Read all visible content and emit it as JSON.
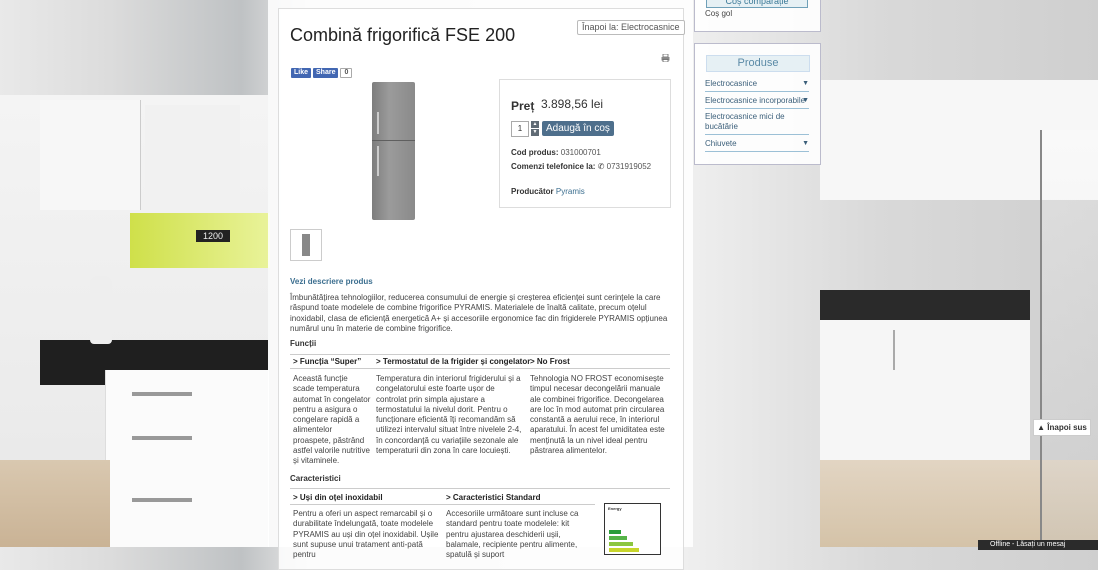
{
  "product": {
    "title": "Combină frigorifică FSE 200",
    "back_link": "Înapoi la: Electrocasnice",
    "price_label": "Preț",
    "price_value": "3.898,56 lei",
    "quantity": "1",
    "add_to_cart": "Adaugă în coș",
    "code_label": "Cod produs:",
    "code_value": "031000701",
    "phone_label": "Comenzi telefonice la:",
    "phone_value": "0731919052",
    "producer_label": "Producător",
    "producer_value": "Pyramis"
  },
  "social": {
    "like": "Like",
    "share": "Share",
    "count": "0"
  },
  "description": {
    "heading": "Vezi descriere produs",
    "text": "Îmbunătățirea tehnologiilor, reducerea consumului de energie și creșterea eficienței sunt cerințele la care răspund toate modelele de combine frigorifice PYRAMIS. Materialele de înaltă calitate, precum oțelul inoxidabil, clasa de eficiență energetică A+ și accesoriile ergonomice fac din frigiderele PYRAMIS opțiunea numărul unu în materie de combine frigorifice."
  },
  "functions": {
    "heading": "Funcții",
    "cols": [
      {
        "title": "> Funcția “Super”",
        "text": "Această funcție scade temperatura automat în congelator pentru a asigura o congelare rapidă a alimentelor proaspete, păstrând astfel valorile nutritive și vitaminele."
      },
      {
        "title": "> Termostatul de la frigider și congelator",
        "text": "Temperatura din interiorul frigiderului și a congelatorului este foarte ușor de controlat prin simpla ajustare a termostatului la nivelul dorit. Pentru o funcționare eficientă îți recomandăm să utilizezi intervalul situat între nivelele 2-4, în concordanță cu variațiile sezonale ale temperaturii din zona în care locuiești."
      },
      {
        "title": "> No Frost",
        "text": "Tehnologia NO FROST economisește timpul necesar decongelării manuale ale combinei frigorifice. Decongelarea are loc în mod automat prin circularea constantă a aerului rece, în interiorul aparatului. În acest fel umiditatea este menținută la un nivel ideal pentru păstrarea alimentelor."
      }
    ]
  },
  "characteristics": {
    "heading": "Caracteristici",
    "cols": [
      {
        "title": "> Uși din oțel inoxidabil",
        "text": "Pentru a oferi un aspect remarcabil și o durabilitate îndelungată, toate modelele PYRAMIS au uși din oțel inoxidabil. Ușile sunt supuse unui tratament anti-pată pentru"
      },
      {
        "title": "> Caracteristici Standard",
        "text": "Accesoriile următoare sunt incluse ca standard pentru toate modelele: kit pentru ajustarea deschiderii ușii, balamale, recipiente pentru alimente, spatulă și suport"
      }
    ],
    "energy_label": "Energy",
    "energy_colors": [
      "#2a9d3a",
      "#55b448",
      "#8cc63f",
      "#c7d52b"
    ]
  },
  "sidebar": {
    "compare_title": "Coș comparație",
    "cart_empty": "Coș gol",
    "products_title": "Produse",
    "items": [
      "Electrocasnice",
      "Electrocasnice incorporabile",
      "Electrocasnice mici de bucătărie",
      "Chiuvete"
    ]
  },
  "back_to_top": "Înapoi sus",
  "offline_label": "Offline - Lăsați un mesaj"
}
